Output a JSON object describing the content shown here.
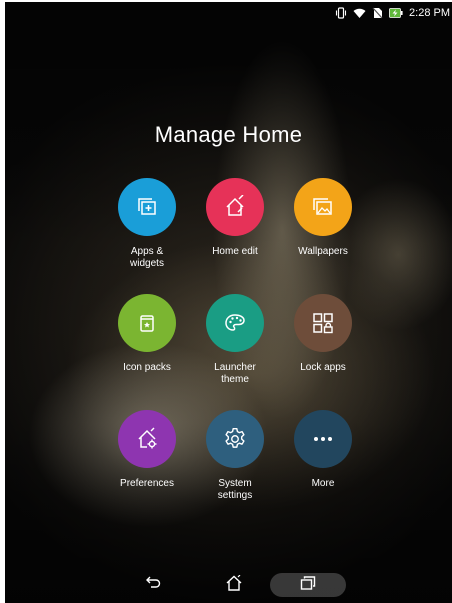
{
  "status_bar": {
    "time": "2:28 PM",
    "icons": [
      "vibrate-icon",
      "wifi-icon",
      "no-sim-icon",
      "battery-charging-icon"
    ]
  },
  "title": "Manage Home",
  "tiles": [
    {
      "label": "Apps &\nwidgets",
      "icon": "apps-widgets-icon",
      "color": "#1a9ed8"
    },
    {
      "label": "Home edit",
      "icon": "home-edit-icon",
      "color": "#e63258"
    },
    {
      "label": "Wallpapers",
      "icon": "wallpapers-icon",
      "color": "#f3a418"
    },
    {
      "label": "Icon packs",
      "icon": "icon-packs-icon",
      "color": "#7bb531"
    },
    {
      "label": "Launcher\ntheme",
      "icon": "palette-icon",
      "color": "#1a9d84"
    },
    {
      "label": "Lock apps",
      "icon": "lock-apps-icon",
      "color": "#6e4d3a"
    },
    {
      "label": "Preferences",
      "icon": "preferences-icon",
      "color": "#8e35b0"
    },
    {
      "label": "System\nsettings",
      "icon": "gear-icon",
      "color": "#2e5f7e"
    },
    {
      "label": "More",
      "icon": "more-icon",
      "color": "#22465e"
    }
  ],
  "nav_bar": {
    "icons": [
      "back-icon",
      "home-icon",
      "recent-apps-icon"
    ]
  }
}
